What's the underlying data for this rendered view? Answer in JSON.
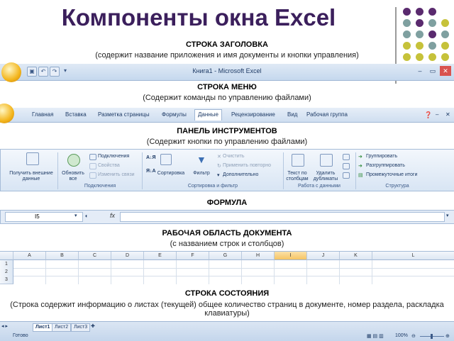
{
  "page_title": "Компоненты окна Excel",
  "sections": {
    "title_bar": {
      "heading": "СТРОКА ЗАГОЛОВКА",
      "desc": "(содержит название приложения и имя документы и кнопки управления)"
    },
    "menu": {
      "heading": "СТРОКА МЕНЮ",
      "desc": "(Содержит команды по управлению файлами)"
    },
    "toolbar": {
      "heading": "ПАНЕЛЬ ИНСТРУМЕНТОВ",
      "desc": "(Содержит кнопки по управлению файлами)"
    },
    "formula": {
      "heading": "ФОРМУЛА"
    },
    "workarea": {
      "heading": "РАБОЧАЯ ОБЛАСТЬ ДОКУМЕНТА",
      "desc": "(с названием строк и столбцов)"
    },
    "status": {
      "heading": "СТРОКА СОСТОЯНИЯ",
      "desc": "(Строка содержит  информацию о листах (текущей) общее количество страниц в документе, номер раздела, раскладка клавиатуры)"
    }
  },
  "excel": {
    "window_title": "Книга1 - Microsoft Excel",
    "win_buttons": [
      "–",
      "▭",
      "✕"
    ],
    "tabs": [
      "Главная",
      "Вставка",
      "Разметка страницы",
      "Формулы",
      "Данные",
      "Рецензирование",
      "Вид",
      "Рабочая группа"
    ],
    "active_tab": "Данные",
    "ribbon": {
      "get_external": "Получить внешние данные",
      "refresh_all": "Обновить все",
      "connections": "Подключения",
      "properties": "Свойства",
      "edit_links": "Изменить связи",
      "group_connections": "Подключения",
      "sort": "Сортировка",
      "filter": "Фильтр",
      "clear": "Очистить",
      "reapply": "Применить повторно",
      "advanced": "Дополнительно",
      "group_sort": "Сортировка и фильтр",
      "text_to_columns": "Текст по столбцам",
      "remove_duplicates": "Удалить дубликаты",
      "group_data_tools": "Работа с данными",
      "group_btn": "Группировать",
      "ungroup_btn": "Разгруппировать",
      "subtotal": "Промежуточные итоги",
      "group_outline": "Структура"
    },
    "name_box": "I5",
    "fx": "fx",
    "columns": [
      "A",
      "B",
      "C",
      "D",
      "E",
      "F",
      "G",
      "H",
      "I",
      "J",
      "K",
      "L"
    ],
    "rows": [
      "1",
      "2",
      "3"
    ],
    "status_ready": "Готово",
    "sheets": [
      "Лист1",
      "Лист2",
      "Лист3"
    ],
    "zoom": "100%"
  },
  "colors": {
    "title": "#3b1f5c",
    "dot_purple": "#5a2a6e",
    "dot_teal": "#7fa0a0",
    "dot_olive": "#c6c23a"
  }
}
